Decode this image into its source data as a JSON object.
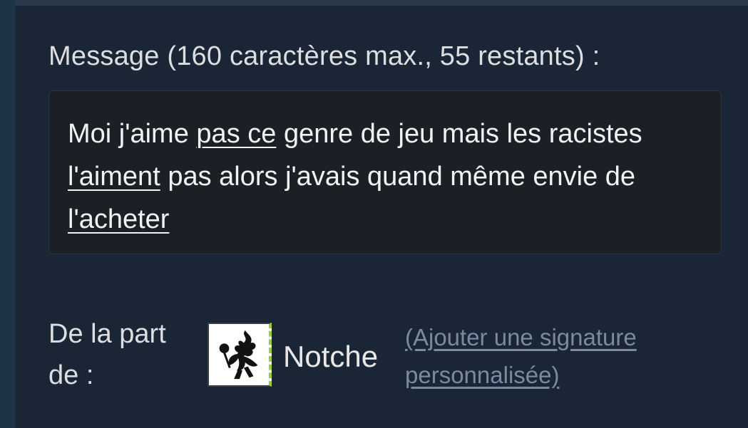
{
  "message": {
    "label": "Message (160 caractères max., 55 restants) :",
    "segments": [
      {
        "text": "Moi j'aime ",
        "underline": false
      },
      {
        "text": "pas ce",
        "underline": true
      },
      {
        "text": " genre de jeu mais les racistes ",
        "underline": false
      },
      {
        "text": "l'aiment",
        "underline": true
      },
      {
        "text": " pas alors j'avais quand même envie de ",
        "underline": false
      },
      {
        "text": "l'acheter",
        "underline": true
      }
    ]
  },
  "from": {
    "label": "De la part de :",
    "sender_name": "Notche",
    "signature_link": "(Ajouter une signature personnalisée)",
    "avatar_icon": "black-flower-silhouette-icon"
  },
  "colors": {
    "background": "#1a2535",
    "text": "#dcdedf",
    "link": "#7c8aa1",
    "avatar_accent": "#9bcf3a"
  }
}
